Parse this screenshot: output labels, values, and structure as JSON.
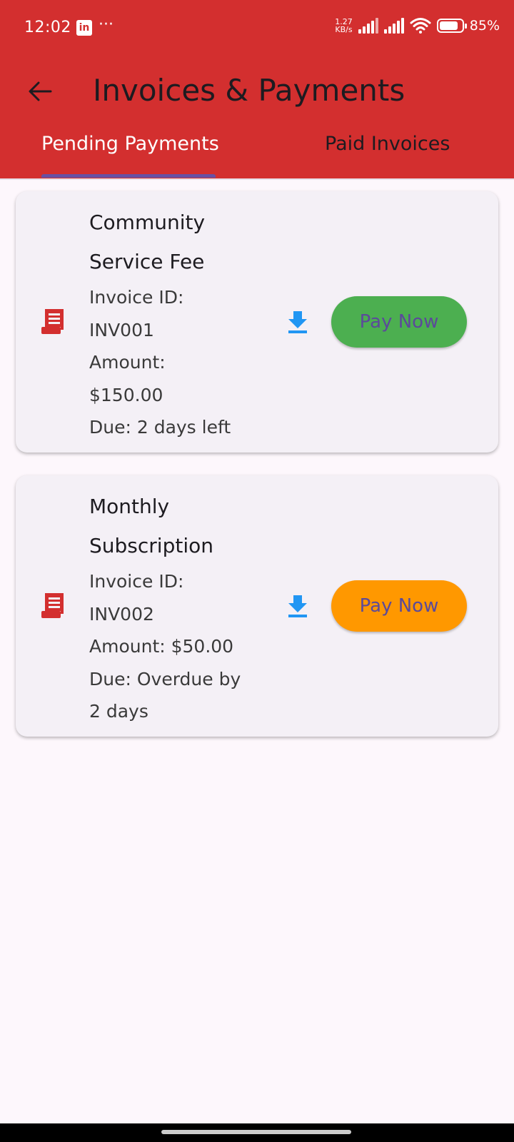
{
  "status_bar": {
    "time": "12:02",
    "app_badge": "in",
    "more": "···",
    "net_speed_value": "1.27",
    "net_speed_unit": "KB/s",
    "battery": "85%"
  },
  "app_bar": {
    "title": "Invoices & Payments"
  },
  "tabs": [
    {
      "label": "Pending Payments",
      "selected": true
    },
    {
      "label": "Paid Invoices",
      "selected": false
    }
  ],
  "invoices": [
    {
      "title_line1": "Community",
      "title_line2": "Service Fee",
      "id_label": "Invoice ID:",
      "id_value": "INV001",
      "amount_line1": "Amount:",
      "amount_line2": "$150.00",
      "due_line1": "Due: 2 days left",
      "due_line2": "",
      "button_label": "Pay Now",
      "button_color": "#4caf50"
    },
    {
      "title_line1": "Monthly",
      "title_line2": "Subscription",
      "id_label": "Invoice ID:",
      "id_value": "INV002",
      "amount_line1": "Amount: $50.00",
      "amount_line2": "",
      "due_line1": "Due: Overdue by",
      "due_line2": "2 days",
      "button_label": "Pay Now",
      "button_color": "#ff9800"
    }
  ],
  "colors": {
    "primary": "#d32f2f",
    "tab_indicator": "#6750a4",
    "download_icon": "#2196f3",
    "receipt_icon": "#d32f2f"
  },
  "icons": {
    "back": "arrow-back-icon",
    "receipt": "receipt-icon",
    "download": "download-icon"
  }
}
